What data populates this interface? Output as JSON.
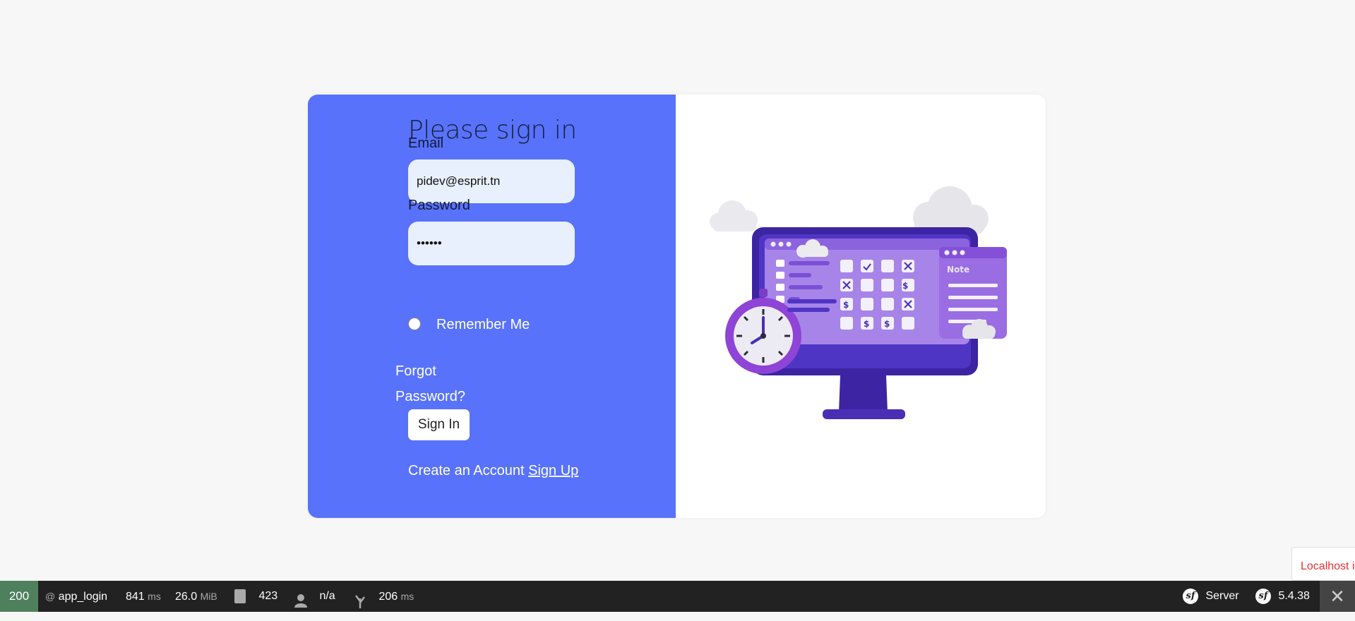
{
  "form": {
    "title": "Please sign in",
    "email_label": "Email",
    "email_value": "pidev@esprit.tn",
    "password_label": "Password",
    "password_value": "••••••",
    "remember_label": "Remember Me",
    "forgot_label": "Forgot Password?",
    "submit_label": "Sign In",
    "create_account_text": "Create an Account",
    "signup_link": "Sign Up"
  },
  "illustration": {
    "note_label": "Note",
    "colors": {
      "panel": "#5872fb",
      "monitor": "#4a2fb5",
      "screen": "#a784e8",
      "clock": "#8e44d6"
    }
  },
  "recaptcha": {
    "text": "Localhost is not supported"
  },
  "toolbar": {
    "status": "200",
    "route": "app_login",
    "time_value": "841",
    "time_unit": "ms",
    "memory_value": "26.0",
    "memory_unit": "MiB",
    "logs_count": "423",
    "user": "n/a",
    "twig_value": "206",
    "twig_unit": "ms",
    "server_label": "Server",
    "version": "5.4.38"
  }
}
